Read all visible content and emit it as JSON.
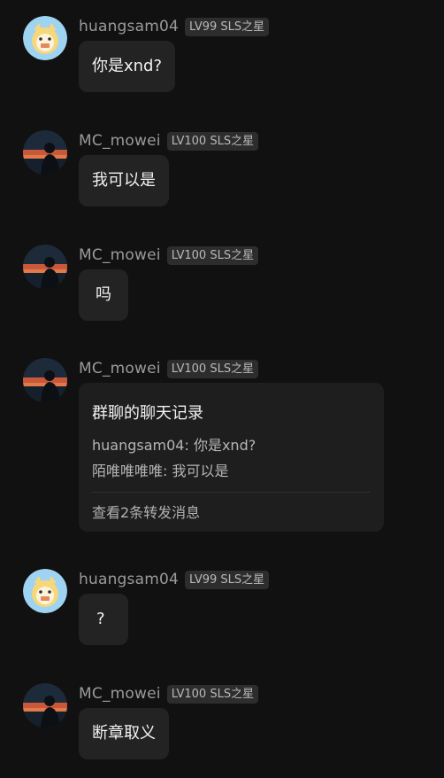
{
  "messages": [
    {
      "user": "huangsam04",
      "badge": "LV99 SLS之星",
      "text": "你是xnd?"
    },
    {
      "user": "MC_mowei",
      "badge": "LV100 SLS之星",
      "text": "我可以是"
    },
    {
      "user": "MC_mowei",
      "badge": "LV100 SLS之星",
      "text": "吗"
    },
    {
      "user": "MC_mowei",
      "badge": "LV100 SLS之星",
      "forward": {
        "title": "群聊的聊天记录",
        "lines": [
          {
            "sender": "huangsam04",
            "text": "你是xnd?"
          },
          {
            "sender": "陌唯唯唯唯",
            "text": "我可以是"
          }
        ],
        "footer": "查看2条转发消息"
      }
    },
    {
      "user": "huangsam04",
      "badge": "LV99 SLS之星",
      "text": "?"
    },
    {
      "user": "MC_mowei",
      "badge": "LV100 SLS之星",
      "text": "断章取义"
    }
  ],
  "avatars": {
    "huangsam04": "cartoon-avatar-icon",
    "MC_mowei": "silhouette-sunset-avatar-icon"
  },
  "colors": {
    "background": "#111111",
    "bubble": "#232323",
    "forward_card": "#1e1e1e",
    "badge": "#2d2d2d",
    "username": "#9a9a9a"
  }
}
